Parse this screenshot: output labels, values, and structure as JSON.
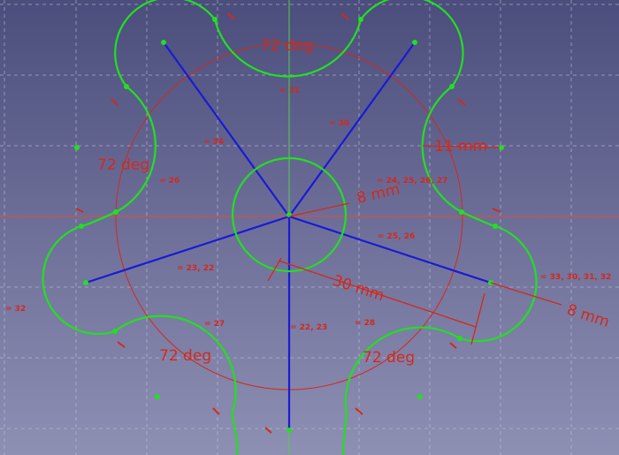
{
  "sketch": {
    "colors": {
      "background_top": "#4b4d7c",
      "background_bottom": "#8d8fb3",
      "geometry": "#21e021",
      "construction": "#1a1ad6",
      "constraint": "#d4281c",
      "x_axis": "#e04a3a",
      "y_axis": "#4fd04f"
    },
    "dimensions": {
      "angle_top": "72 deg",
      "angle_left": "72 deg",
      "angle_bottom_left": "72 deg",
      "angle_bottom_right": "72 deg",
      "radius_hub": "8 mm",
      "radius_lobe": "11 mm",
      "length_spoke": "30 mm",
      "length_tip": "8 mm"
    },
    "constraint_labels": {
      "c1": "31",
      "c2": "30",
      "c3": "34",
      "c4": "26",
      "c5": "24, 25, 26, 27",
      "c6": "25, 26",
      "c7": "23, 22",
      "c8": "27",
      "c9": "22, 23",
      "c10": "28",
      "c11": "33, 30, 31, 32",
      "c12": "32"
    }
  }
}
